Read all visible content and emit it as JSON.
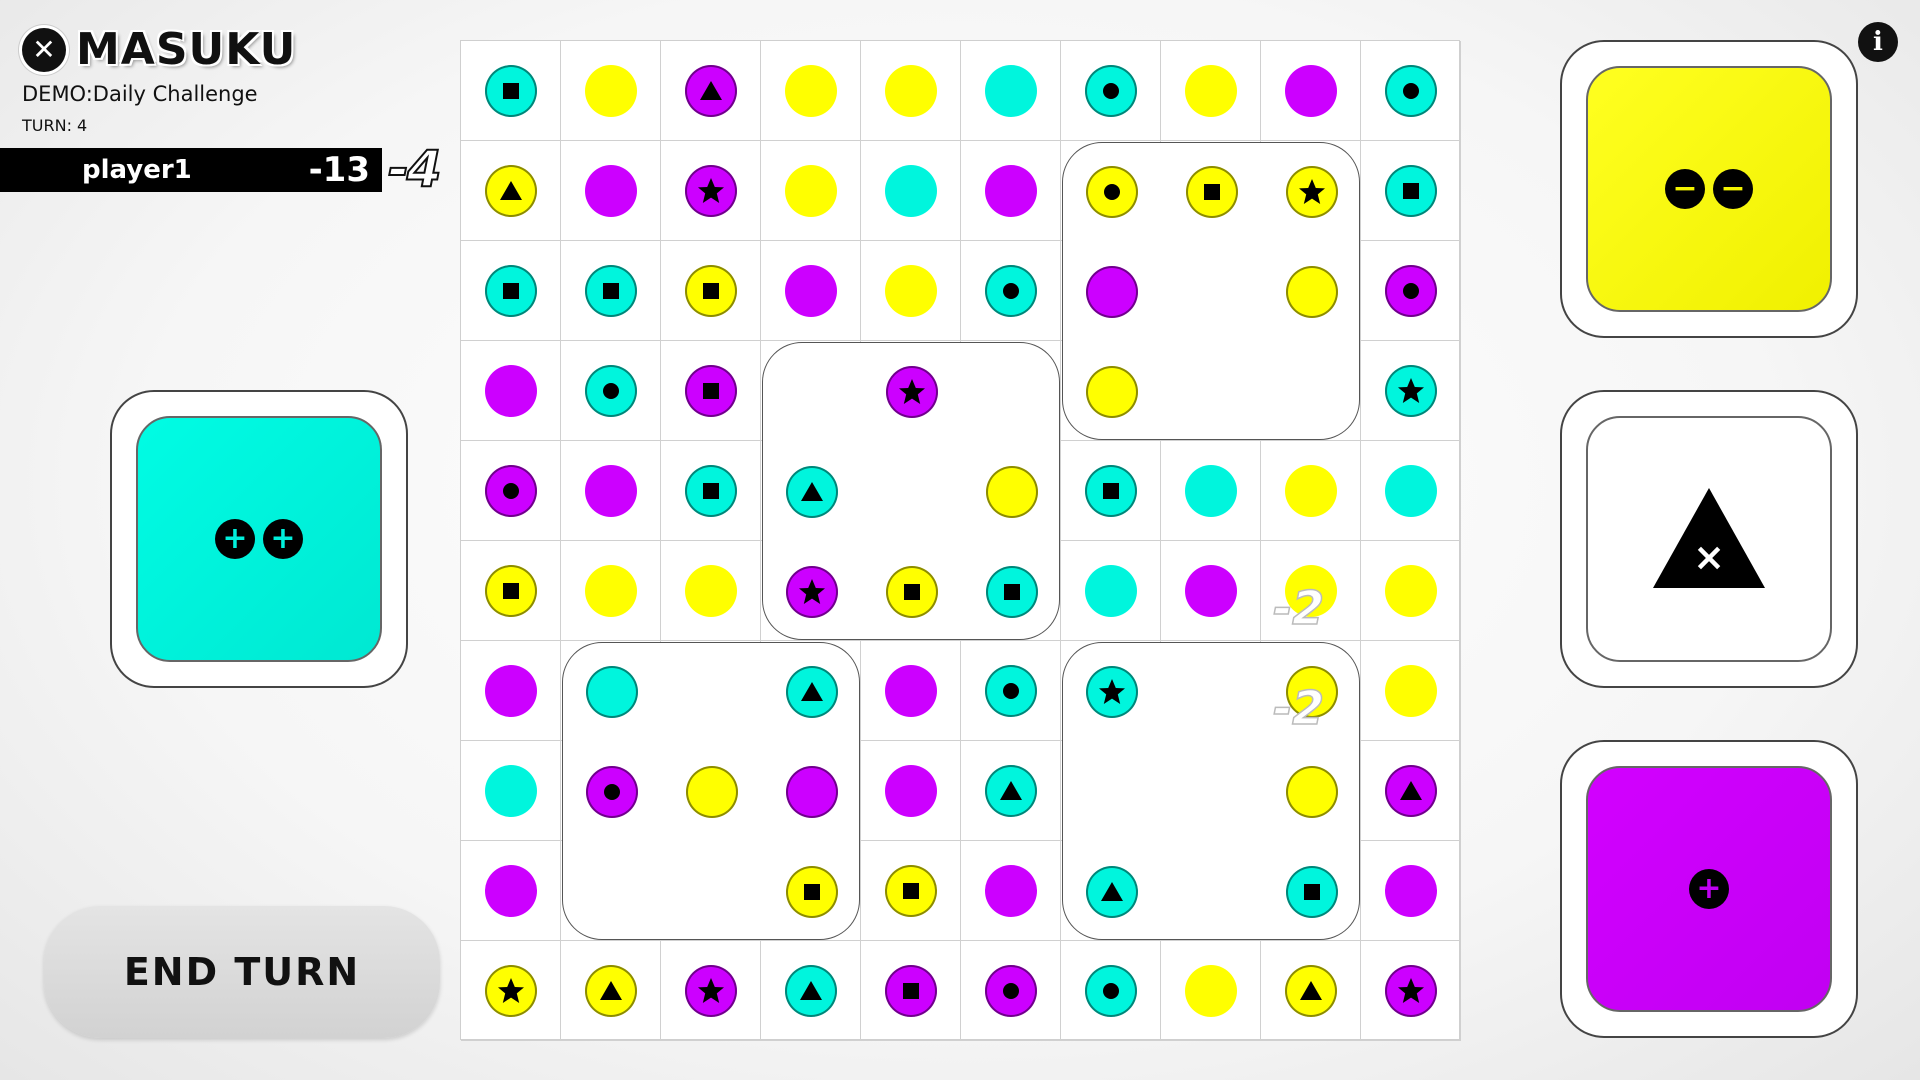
{
  "header": {
    "close_icon": "close-icon",
    "title": "MASUKU",
    "mode": "DEMO:Daily Challenge",
    "turn": "TURN: 4"
  },
  "player": {
    "name": "player1",
    "score": "-13",
    "delta": "-4"
  },
  "info_icon": "info-icon",
  "colors": {
    "cyan": "#00f5dd",
    "yellow": "#ffff00",
    "magenta": "#cc00ff"
  },
  "board": {
    "size": 10,
    "rows": [
      [
        [
          "c",
          "square"
        ],
        [
          "y",
          ""
        ],
        [
          "m",
          "triangle"
        ],
        [
          "y",
          ""
        ],
        [
          "y",
          ""
        ],
        [
          "c",
          ""
        ],
        [
          "c",
          "circle"
        ],
        [
          "y",
          ""
        ],
        [
          "m",
          ""
        ],
        [
          "c",
          "circle"
        ]
      ],
      [
        [
          "y",
          "triangle"
        ],
        [
          "m",
          ""
        ],
        [
          "m",
          "star"
        ],
        [
          "y",
          ""
        ],
        [
          "c",
          ""
        ],
        [
          "m",
          ""
        ],
        [
          "y",
          "circle"
        ],
        [
          "y",
          "square"
        ],
        [
          "y",
          "star"
        ],
        [
          "c",
          "square"
        ]
      ],
      [
        [
          "c",
          "square"
        ],
        [
          "c",
          "square"
        ],
        [
          "y",
          "square"
        ],
        [
          "m",
          ""
        ],
        [
          "y",
          ""
        ],
        [
          "c",
          "circle"
        ],
        [
          "m",
          ""
        ],
        [
          "",
          ""
        ],
        [
          "y",
          ""
        ],
        [
          "m",
          "circle"
        ]
      ],
      [
        [
          "m",
          ""
        ],
        [
          "c",
          "circle"
        ],
        [
          "m",
          "square"
        ],
        [
          "",
          ""
        ],
        [
          "m",
          "star"
        ],
        [
          "",
          ""
        ],
        [
          "y",
          ""
        ],
        [
          "",
          ""
        ],
        [
          "",
          ""
        ],
        [
          "c",
          "star"
        ]
      ],
      [
        [
          "m",
          "circle"
        ],
        [
          "m",
          ""
        ],
        [
          "c",
          "square"
        ],
        [
          "c",
          "triangle"
        ],
        [
          "",
          ""
        ],
        [
          "y",
          ""
        ],
        [
          "c",
          "square"
        ],
        [
          "c",
          ""
        ],
        [
          "y",
          ""
        ],
        [
          "c",
          ""
        ]
      ],
      [
        [
          "y",
          "square"
        ],
        [
          "y",
          ""
        ],
        [
          "y",
          ""
        ],
        [
          "m",
          "star"
        ],
        [
          "y",
          "square"
        ],
        [
          "c",
          "square"
        ],
        [
          "c",
          ""
        ],
        [
          "m",
          ""
        ],
        [
          "y",
          ""
        ],
        [
          "y",
          ""
        ]
      ],
      [
        [
          "m",
          ""
        ],
        [
          "c",
          ""
        ],
        [
          "",
          ""
        ],
        [
          "c",
          "triangle"
        ],
        [
          "m",
          ""
        ],
        [
          "c",
          "circle"
        ],
        [
          "c",
          "star"
        ],
        [
          "",
          ""
        ],
        [
          "y",
          ""
        ],
        [
          "y",
          ""
        ]
      ],
      [
        [
          "c",
          ""
        ],
        [
          "m",
          "circle"
        ],
        [
          "y",
          ""
        ],
        [
          "m",
          ""
        ],
        [
          "m",
          ""
        ],
        [
          "c",
          "triangle"
        ],
        [
          "",
          ""
        ],
        [
          "",
          ""
        ],
        [
          "y",
          ""
        ],
        [
          "m",
          "triangle"
        ]
      ],
      [
        [
          "m",
          ""
        ],
        [
          "",
          ""
        ],
        [
          "",
          ""
        ],
        [
          "y",
          "square"
        ],
        [
          "y",
          "square"
        ],
        [
          "m",
          ""
        ],
        [
          "c",
          "triangle"
        ],
        [
          "",
          ""
        ],
        [
          "c",
          "square"
        ],
        [
          "m",
          ""
        ]
      ],
      [
        [
          "y",
          "star"
        ],
        [
          "y",
          "triangle"
        ],
        [
          "m",
          "star"
        ],
        [
          "c",
          "triangle"
        ],
        [
          "m",
          "square"
        ],
        [
          "m",
          "circle"
        ],
        [
          "c",
          "circle"
        ],
        [
          "y",
          ""
        ],
        [
          "y",
          "triangle"
        ],
        [
          "m",
          "star"
        ]
      ]
    ],
    "tiles": [
      {
        "col": 6,
        "row": 1,
        "cells": [
          [
            0,
            0
          ],
          [
            1,
            0
          ],
          [
            2,
            0
          ],
          [
            0,
            1
          ],
          [
            2,
            1
          ],
          [
            0,
            2
          ]
        ]
      },
      {
        "col": 3,
        "row": 3,
        "cells": [
          [
            1,
            0
          ],
          [
            0,
            1
          ],
          [
            2,
            1
          ],
          [
            0,
            2
          ],
          [
            1,
            2
          ],
          [
            2,
            2
          ]
        ]
      },
      {
        "col": 1,
        "row": 6,
        "cells": [
          [
            0,
            0
          ],
          [
            2,
            0
          ],
          [
            0,
            1
          ],
          [
            1,
            1
          ],
          [
            2,
            1
          ],
          [
            2,
            2
          ]
        ]
      },
      {
        "col": 6,
        "row": 6,
        "cells": [
          [
            0,
            0
          ],
          [
            2,
            0
          ],
          [
            2,
            1
          ],
          [
            0,
            2
          ],
          [
            2,
            2
          ]
        ]
      }
    ],
    "float_labels": [
      {
        "text": "-2",
        "col": 8,
        "row": 5
      },
      {
        "text": "-2",
        "col": 8,
        "row": 6
      }
    ]
  },
  "cards": {
    "left": {
      "color": "cyan",
      "symbols": [
        "+",
        "+"
      ],
      "icon": "plus-plus-icon"
    },
    "right_top": {
      "color": "yellow",
      "symbols": [
        "−",
        "−"
      ],
      "icon": "minus-minus-icon"
    },
    "right_mid": {
      "color": "white",
      "symbols": [
        "×"
      ],
      "icon": "triangle-x-icon"
    },
    "right_bottom": {
      "color": "magenta",
      "symbols": [
        "+"
      ],
      "icon": "plus-icon"
    }
  },
  "end_turn": {
    "label": "END TURN"
  }
}
